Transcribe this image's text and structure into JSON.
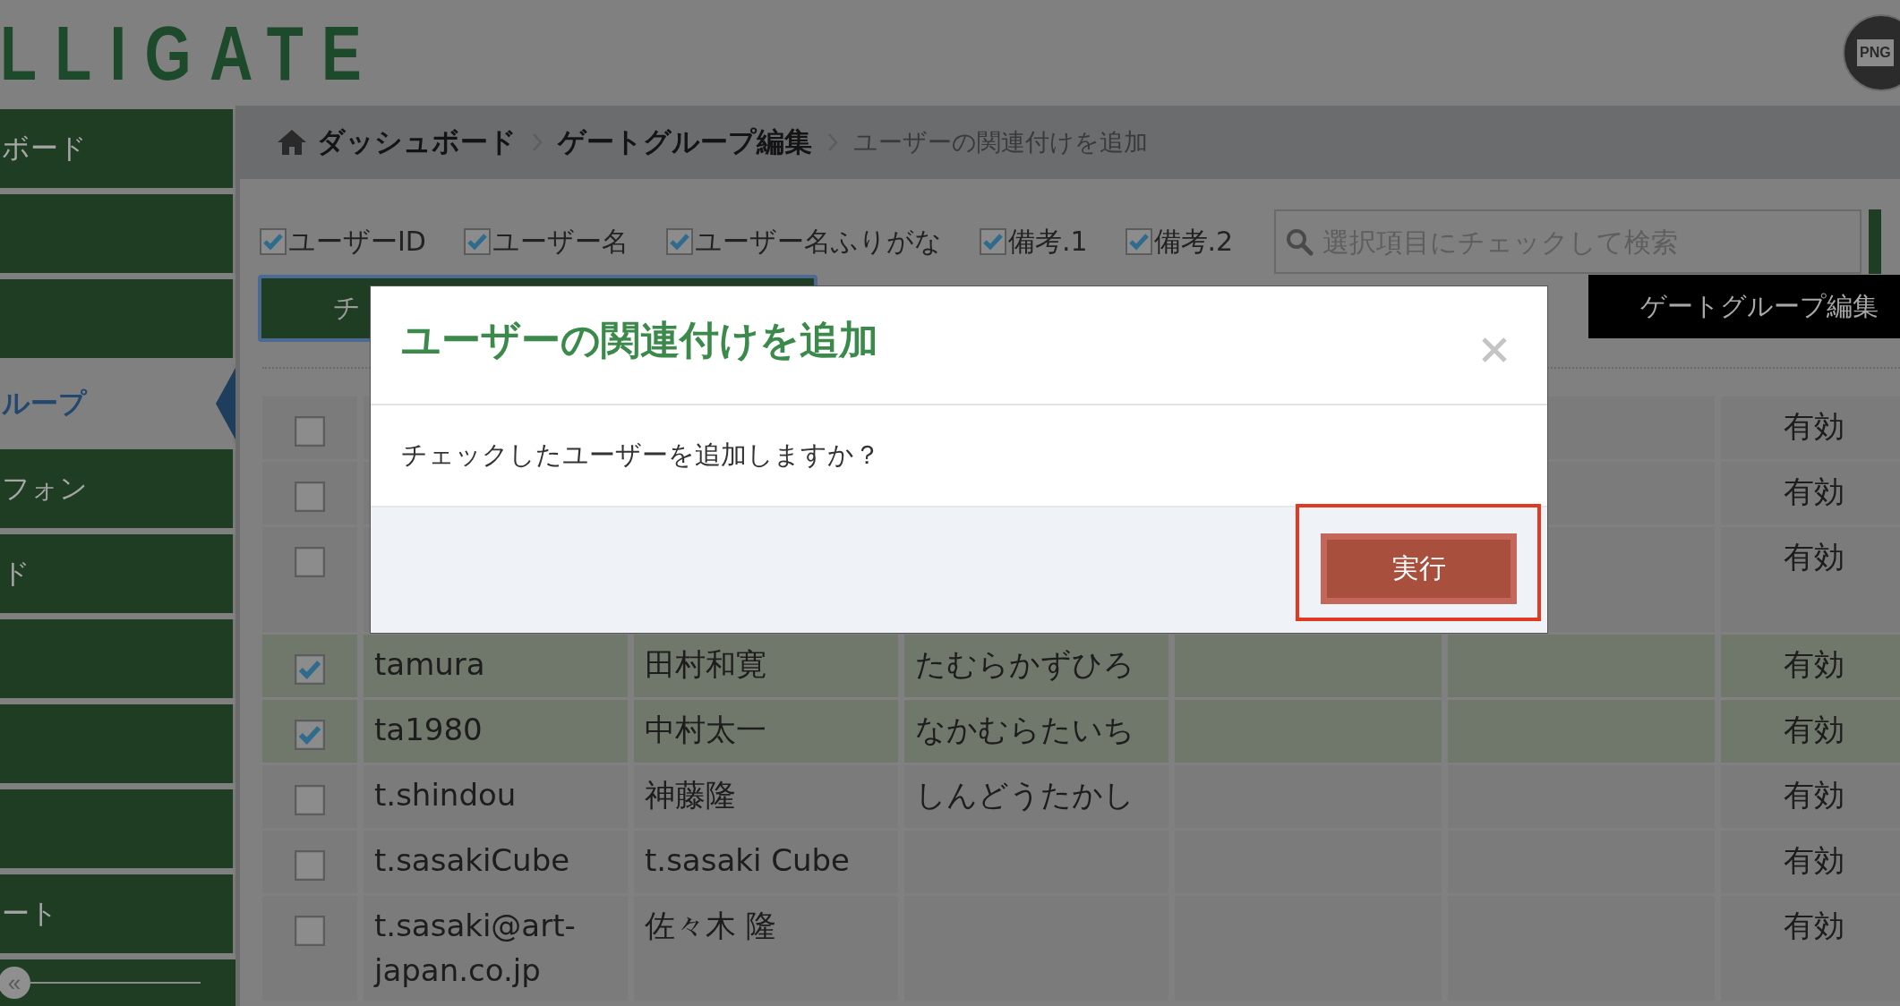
{
  "header": {
    "logo": "LLIGATE",
    "avatar": "PNG"
  },
  "sidebar": {
    "items": [
      {
        "label": "ボード",
        "selected": false
      },
      {
        "selected": false
      },
      {
        "selected": false
      },
      {
        "label": "ループ",
        "selected": true
      },
      {
        "label": "フォン",
        "selected": false
      },
      {
        "label": "ド",
        "selected": false
      },
      {
        "selected": false
      },
      {
        "selected": false
      },
      {
        "selected": false
      },
      {
        "label": "ート",
        "selected": false
      }
    ],
    "collapse": "«"
  },
  "breadcrumb": [
    {
      "label": "ダッシュボード",
      "kind": "home"
    },
    {
      "label": "ゲートグループ編集",
      "kind": "link"
    },
    {
      "label": "ユーザーの関連付けを追加",
      "kind": "current"
    }
  ],
  "filters": [
    {
      "label": "ユーザーID",
      "checked": true
    },
    {
      "label": "ユーザー名",
      "checked": true
    },
    {
      "label": "ユーザー名ふりがな",
      "checked": true
    },
    {
      "label": "備考.1",
      "checked": true
    },
    {
      "label": "備考.2",
      "checked": true
    }
  ],
  "search": {
    "placeholder": "選択項目にチェックして検索"
  },
  "check_button": {
    "label": "チ"
  },
  "gate_group_button": {
    "label": "ゲートグループ編集"
  },
  "table": {
    "rows": [
      {
        "checked": false,
        "status": "有効"
      },
      {
        "checked": false,
        "status": "有効"
      },
      {
        "checked": false,
        "status": "有効",
        "tall": true
      },
      {
        "checked": true,
        "user_id": "tamura",
        "name": "田村和寛",
        "kana": "たむらかずひろ",
        "status": "有効"
      },
      {
        "checked": true,
        "user_id": "ta1980",
        "name": "中村太一",
        "kana": "なかむらたいち",
        "status": "有効"
      },
      {
        "checked": false,
        "user_id": "t.shindou",
        "name": "神藤隆",
        "kana": "しんどうたかし",
        "status": "有効"
      },
      {
        "checked": false,
        "user_id": "t.sasakiCube",
        "name": "t.sasaki Cube",
        "status": "有効"
      },
      {
        "checked": false,
        "user_id": "t.sasaki@art-japan.co.jp",
        "name": "佐々木 隆",
        "status": "有効",
        "tall": true
      }
    ]
  },
  "modal": {
    "title": "ユーザーの関連付けを追加",
    "message": "チェックしたユーザーを追加しますか？",
    "button": "実行",
    "highlighted": true
  }
}
